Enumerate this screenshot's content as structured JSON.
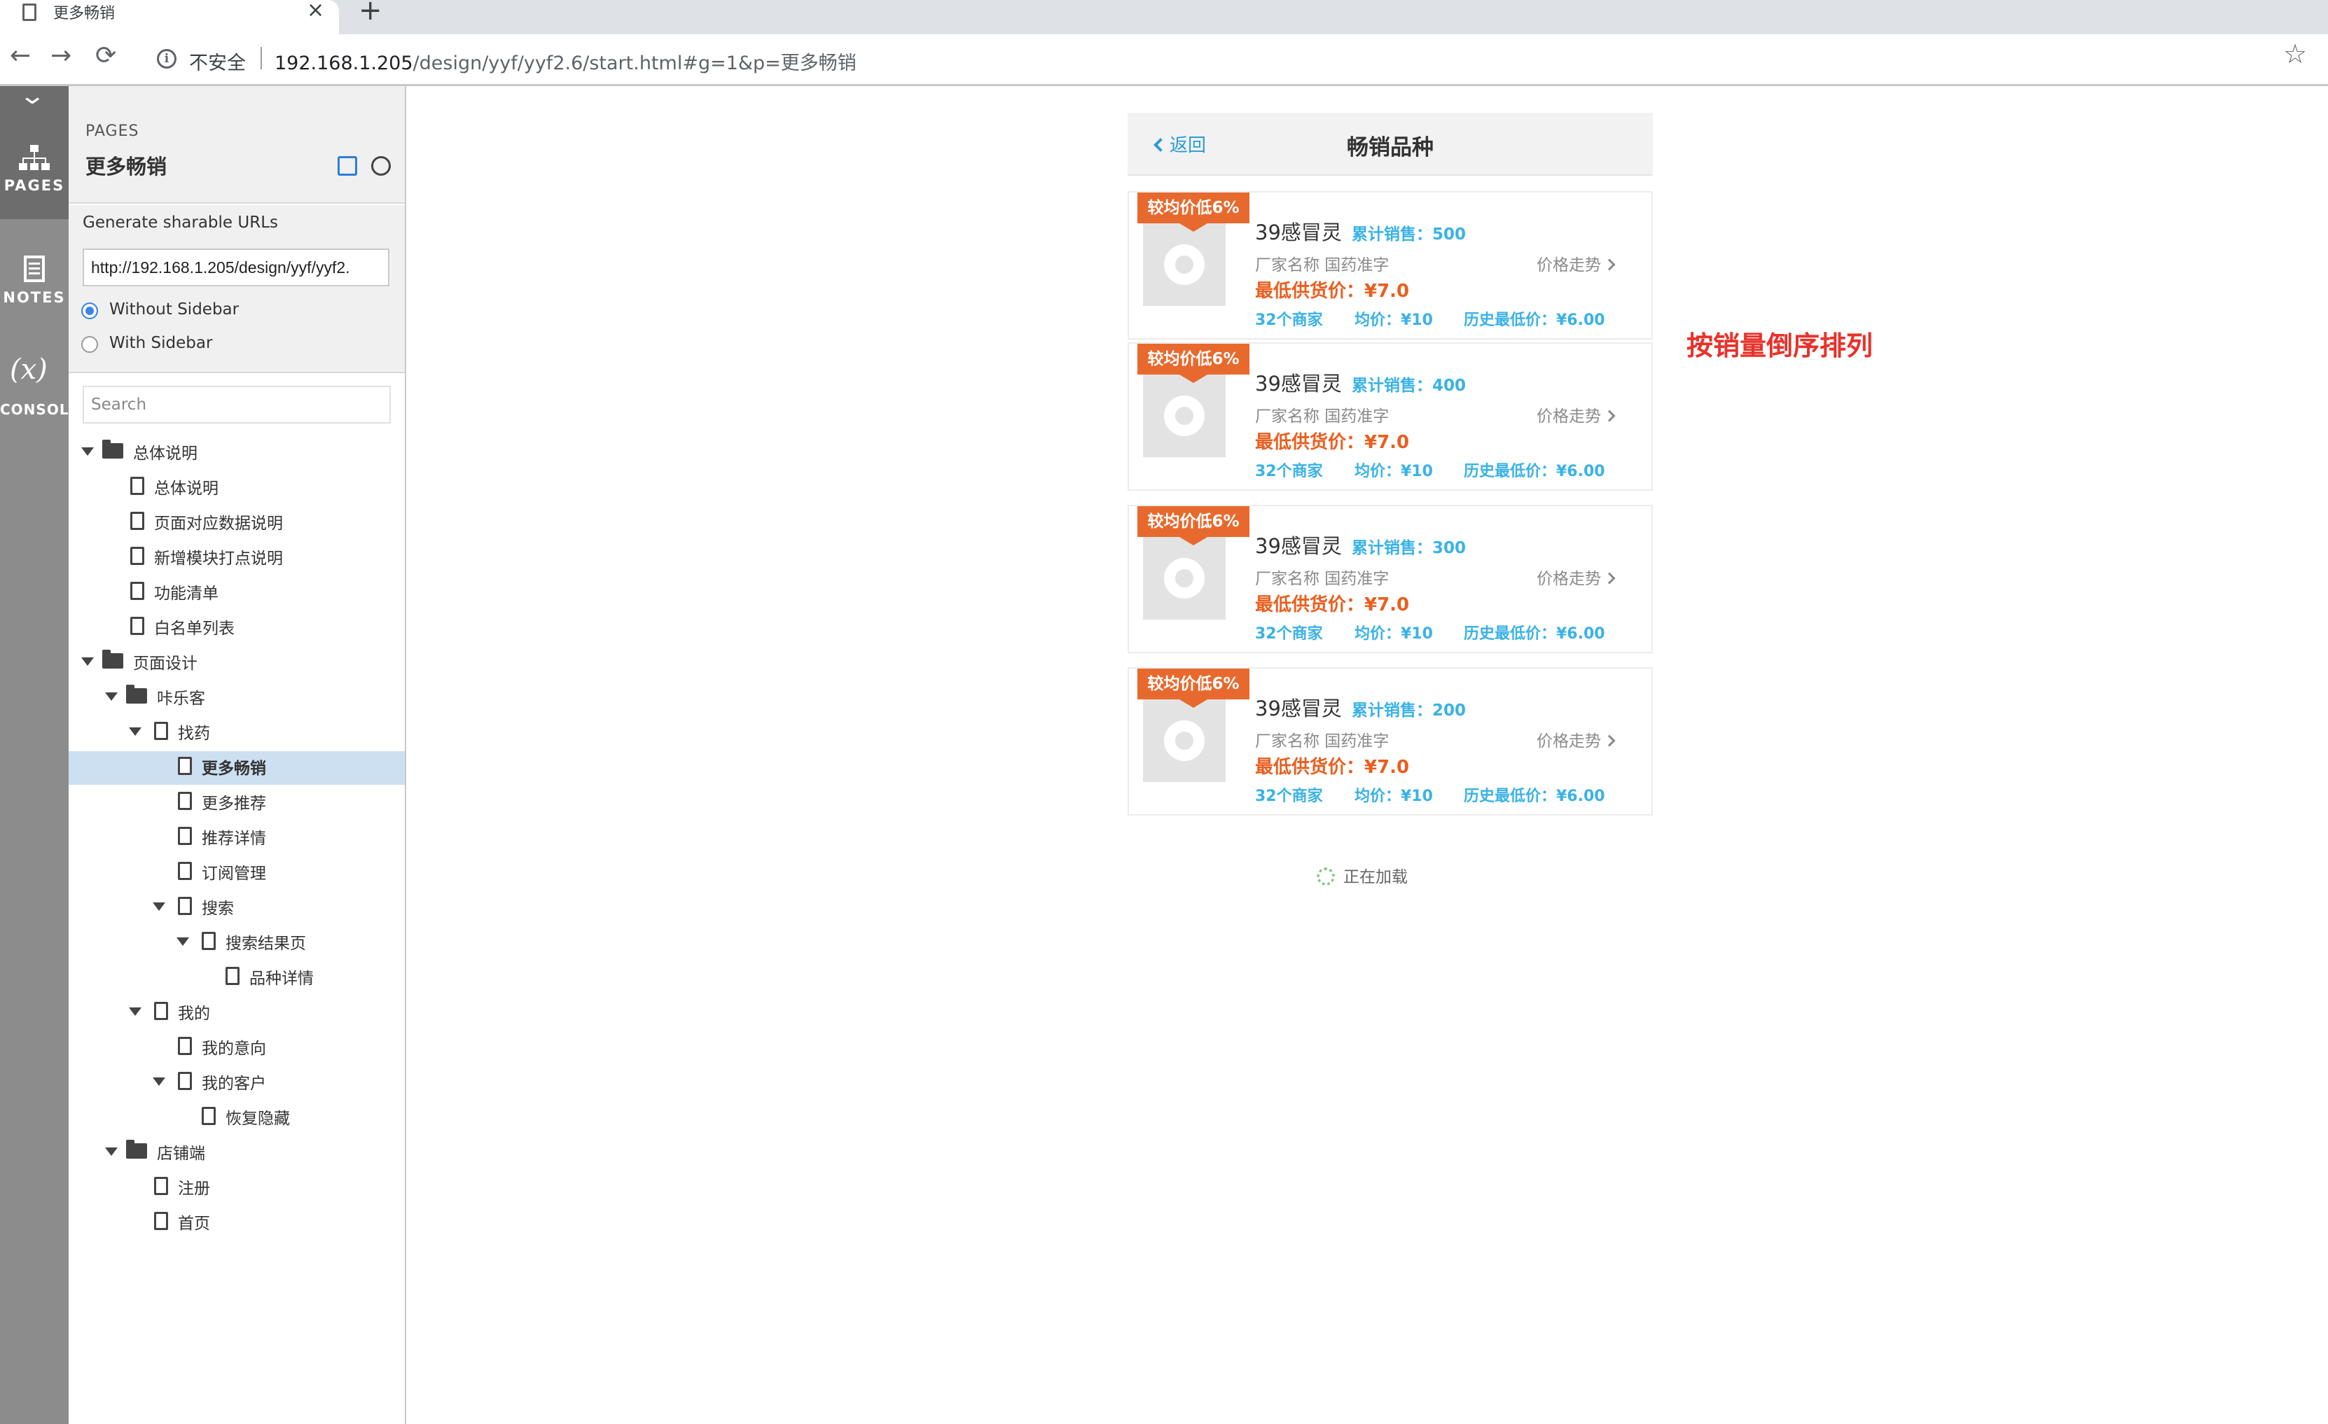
{
  "browser": {
    "tab_title": "更多畅销",
    "tab_close": "×",
    "new_tab": "+",
    "back": "←",
    "forward": "→",
    "reload": "⟳",
    "insecure_label": "不安全",
    "url_host": "192.168.1.205",
    "url_path": "/design/yyf/yyf2.6/start.html#g=1&p=更多畅销",
    "star": "☆"
  },
  "rail": {
    "collapse": "⌄",
    "items": [
      {
        "label": "PAGES",
        "icon": "sitemap-icon"
      },
      {
        "label": "NOTES",
        "icon": "notes-icon"
      },
      {
        "label": "CONSOLE",
        "icon": "variable-x-icon"
      }
    ]
  },
  "sidebar": {
    "kicker": "PAGES",
    "current_page": "更多畅销",
    "share": {
      "title": "Generate sharable URLs",
      "url_value": "http://192.168.1.205/design/yyf/yyf2.",
      "options": [
        "Without Sidebar",
        "With Sidebar"
      ],
      "selected": "Without Sidebar"
    },
    "search_placeholder": "Search",
    "tree": [
      {
        "label": "总体说明",
        "type": "folder",
        "depth": 0,
        "expanded": true
      },
      {
        "label": "总体说明",
        "type": "page",
        "depth": 1
      },
      {
        "label": "页面对应数据说明",
        "type": "page",
        "depth": 1
      },
      {
        "label": "新增模块打点说明",
        "type": "page",
        "depth": 1
      },
      {
        "label": "功能清单",
        "type": "page",
        "depth": 1
      },
      {
        "label": "白名单列表",
        "type": "page",
        "depth": 1
      },
      {
        "label": "页面设计",
        "type": "folder",
        "depth": 0,
        "expanded": true
      },
      {
        "label": "咔乐客",
        "type": "folder",
        "depth": 1,
        "expanded": true
      },
      {
        "label": "找药",
        "type": "page",
        "depth": 2,
        "expanded": true
      },
      {
        "label": "更多畅销",
        "type": "page",
        "depth": 3,
        "selected": true
      },
      {
        "label": "更多推荐",
        "type": "page",
        "depth": 3
      },
      {
        "label": "推荐详情",
        "type": "page",
        "depth": 3
      },
      {
        "label": "订阅管理",
        "type": "page",
        "depth": 3
      },
      {
        "label": "搜索",
        "type": "page",
        "depth": 3,
        "expanded": true
      },
      {
        "label": "搜索结果页",
        "type": "page",
        "depth": 4,
        "expanded": true
      },
      {
        "label": "品种详情",
        "type": "page",
        "depth": 5
      },
      {
        "label": "我的",
        "type": "page",
        "depth": 2,
        "expanded": true
      },
      {
        "label": "我的意向",
        "type": "page",
        "depth": 3
      },
      {
        "label": "我的客户",
        "type": "page",
        "depth": 3,
        "expanded": true
      },
      {
        "label": "恢复隐藏",
        "type": "page",
        "depth": 4
      },
      {
        "label": "店铺端",
        "type": "folder",
        "depth": 1,
        "expanded": true
      },
      {
        "label": "注册",
        "type": "page",
        "depth": 2
      },
      {
        "label": "首页",
        "type": "page",
        "depth": 2
      }
    ]
  },
  "phone": {
    "back_label": "返回",
    "title": "畅销品种",
    "products": [
      {
        "badge": "较均价低6%",
        "name": "39感冒灵",
        "sales": "累计销售：500",
        "maker": "厂家名称 国药准字",
        "trend": "价格走势",
        "min_price": "最低供货价：¥7.0",
        "merchants": "32个商家",
        "avg": "均价：¥10",
        "hist_low": "历史最低价：¥6.00"
      },
      {
        "badge": "较均价低6%",
        "name": "39感冒灵",
        "sales": "累计销售：400",
        "maker": "厂家名称 国药准字",
        "trend": "价格走势",
        "min_price": "最低供货价：¥7.0",
        "merchants": "32个商家",
        "avg": "均价：¥10",
        "hist_low": "历史最低价：¥6.00"
      },
      {
        "badge": "较均价低6%",
        "name": "39感冒灵",
        "sales": "累计销售：300",
        "maker": "厂家名称 国药准字",
        "trend": "价格走势",
        "min_price": "最低供货价：¥7.0",
        "merchants": "32个商家",
        "avg": "均价：¥10",
        "hist_low": "历史最低价：¥6.00"
      },
      {
        "badge": "较均价低6%",
        "name": "39感冒灵",
        "sales": "累计销售：200",
        "maker": "厂家名称 国药准字",
        "trend": "价格走势",
        "min_price": "最低供货价：¥7.0",
        "merchants": "32个商家",
        "avg": "均价：¥10",
        "hist_low": "历史最低价：¥6.00"
      }
    ],
    "loading": "正在加载"
  },
  "annotation": "按销量倒序排列",
  "colors": {
    "accent_blue": "#39b2e6",
    "badge_orange": "#e8692d",
    "price_orange": "#ea5e1e",
    "annotation_red": "#e8312a",
    "selected_row": "#cde0f1"
  }
}
